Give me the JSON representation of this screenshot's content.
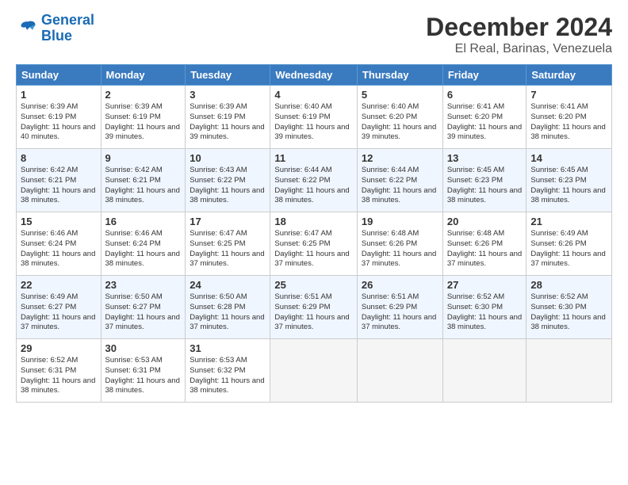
{
  "logo": {
    "line1": "General",
    "line2": "Blue"
  },
  "title": "December 2024",
  "subtitle": "El Real, Barinas, Venezuela",
  "headers": [
    "Sunday",
    "Monday",
    "Tuesday",
    "Wednesday",
    "Thursday",
    "Friday",
    "Saturday"
  ],
  "weeks": [
    [
      {
        "day": "1",
        "sunrise": "6:39 AM",
        "sunset": "6:19 PM",
        "daylight": "11 hours and 40 minutes."
      },
      {
        "day": "2",
        "sunrise": "6:39 AM",
        "sunset": "6:19 PM",
        "daylight": "11 hours and 39 minutes."
      },
      {
        "day": "3",
        "sunrise": "6:39 AM",
        "sunset": "6:19 PM",
        "daylight": "11 hours and 39 minutes."
      },
      {
        "day": "4",
        "sunrise": "6:40 AM",
        "sunset": "6:19 PM",
        "daylight": "11 hours and 39 minutes."
      },
      {
        "day": "5",
        "sunrise": "6:40 AM",
        "sunset": "6:20 PM",
        "daylight": "11 hours and 39 minutes."
      },
      {
        "day": "6",
        "sunrise": "6:41 AM",
        "sunset": "6:20 PM",
        "daylight": "11 hours and 39 minutes."
      },
      {
        "day": "7",
        "sunrise": "6:41 AM",
        "sunset": "6:20 PM",
        "daylight": "11 hours and 38 minutes."
      }
    ],
    [
      {
        "day": "8",
        "sunrise": "6:42 AM",
        "sunset": "6:21 PM",
        "daylight": "11 hours and 38 minutes."
      },
      {
        "day": "9",
        "sunrise": "6:42 AM",
        "sunset": "6:21 PM",
        "daylight": "11 hours and 38 minutes."
      },
      {
        "day": "10",
        "sunrise": "6:43 AM",
        "sunset": "6:22 PM",
        "daylight": "11 hours and 38 minutes."
      },
      {
        "day": "11",
        "sunrise": "6:44 AM",
        "sunset": "6:22 PM",
        "daylight": "11 hours and 38 minutes."
      },
      {
        "day": "12",
        "sunrise": "6:44 AM",
        "sunset": "6:22 PM",
        "daylight": "11 hours and 38 minutes."
      },
      {
        "day": "13",
        "sunrise": "6:45 AM",
        "sunset": "6:23 PM",
        "daylight": "11 hours and 38 minutes."
      },
      {
        "day": "14",
        "sunrise": "6:45 AM",
        "sunset": "6:23 PM",
        "daylight": "11 hours and 38 minutes."
      }
    ],
    [
      {
        "day": "15",
        "sunrise": "6:46 AM",
        "sunset": "6:24 PM",
        "daylight": "11 hours and 38 minutes."
      },
      {
        "day": "16",
        "sunrise": "6:46 AM",
        "sunset": "6:24 PM",
        "daylight": "11 hours and 38 minutes."
      },
      {
        "day": "17",
        "sunrise": "6:47 AM",
        "sunset": "6:25 PM",
        "daylight": "11 hours and 37 minutes."
      },
      {
        "day": "18",
        "sunrise": "6:47 AM",
        "sunset": "6:25 PM",
        "daylight": "11 hours and 37 minutes."
      },
      {
        "day": "19",
        "sunrise": "6:48 AM",
        "sunset": "6:26 PM",
        "daylight": "11 hours and 37 minutes."
      },
      {
        "day": "20",
        "sunrise": "6:48 AM",
        "sunset": "6:26 PM",
        "daylight": "11 hours and 37 minutes."
      },
      {
        "day": "21",
        "sunrise": "6:49 AM",
        "sunset": "6:26 PM",
        "daylight": "11 hours and 37 minutes."
      }
    ],
    [
      {
        "day": "22",
        "sunrise": "6:49 AM",
        "sunset": "6:27 PM",
        "daylight": "11 hours and 37 minutes."
      },
      {
        "day": "23",
        "sunrise": "6:50 AM",
        "sunset": "6:27 PM",
        "daylight": "11 hours and 37 minutes."
      },
      {
        "day": "24",
        "sunrise": "6:50 AM",
        "sunset": "6:28 PM",
        "daylight": "11 hours and 37 minutes."
      },
      {
        "day": "25",
        "sunrise": "6:51 AM",
        "sunset": "6:29 PM",
        "daylight": "11 hours and 37 minutes."
      },
      {
        "day": "26",
        "sunrise": "6:51 AM",
        "sunset": "6:29 PM",
        "daylight": "11 hours and 37 minutes."
      },
      {
        "day": "27",
        "sunrise": "6:52 AM",
        "sunset": "6:30 PM",
        "daylight": "11 hours and 38 minutes."
      },
      {
        "day": "28",
        "sunrise": "6:52 AM",
        "sunset": "6:30 PM",
        "daylight": "11 hours and 38 minutes."
      }
    ],
    [
      {
        "day": "29",
        "sunrise": "6:52 AM",
        "sunset": "6:31 PM",
        "daylight": "11 hours and 38 minutes."
      },
      {
        "day": "30",
        "sunrise": "6:53 AM",
        "sunset": "6:31 PM",
        "daylight": "11 hours and 38 minutes."
      },
      {
        "day": "31",
        "sunrise": "6:53 AM",
        "sunset": "6:32 PM",
        "daylight": "11 hours and 38 minutes."
      },
      null,
      null,
      null,
      null
    ]
  ]
}
